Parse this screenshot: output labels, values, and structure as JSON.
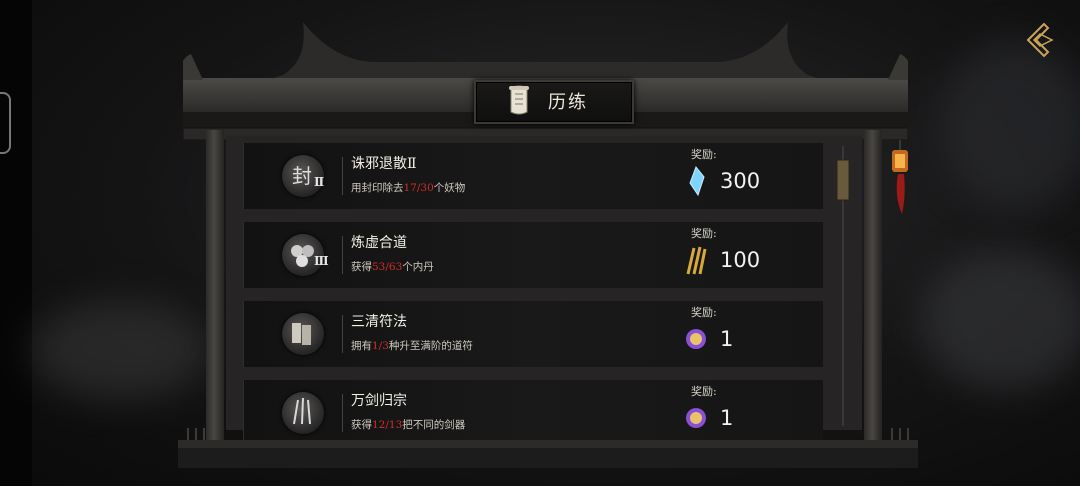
{
  "header": {
    "title": "历练"
  },
  "achievements": [
    {
      "name": "诛邪退散Ⅱ",
      "icon": "seal-icon",
      "tier": "Ⅱ",
      "desc_before": "用封印除去",
      "progress": "17/30",
      "desc_after": "个妖物",
      "reward_label": "奖励:",
      "reward_icon": "spirit-crystal-icon",
      "reward_amount": "300"
    },
    {
      "name": "炼虚合道",
      "icon": "orbs-icon",
      "tier": "Ⅲ",
      "desc_before": "获得",
      "progress": "53/63",
      "desc_after": "个内丹",
      "reward_label": "奖励:",
      "reward_icon": "golden-talisman-icon",
      "reward_amount": "100"
    },
    {
      "name": "三清符法",
      "icon": "talisman-icon",
      "tier": "",
      "desc_before": "拥有",
      "progress": "1/3",
      "desc_after": "种升至满阶的道符",
      "reward_label": "奖励:",
      "reward_icon": "purple-orb-icon",
      "reward_amount": "1"
    },
    {
      "name": "万剑归宗",
      "icon": "swords-icon",
      "tier": "",
      "desc_before": "获得",
      "progress": "12/13",
      "desc_after": "把不同的剑器",
      "reward_label": "奖励:",
      "reward_icon": "purple-orb-icon",
      "reward_amount": "1"
    }
  ],
  "colors": {
    "progress": "#d42b2b",
    "crystal": "#7fd4ff",
    "gold": "#d8a93a",
    "orb": "#8a4fd6"
  }
}
